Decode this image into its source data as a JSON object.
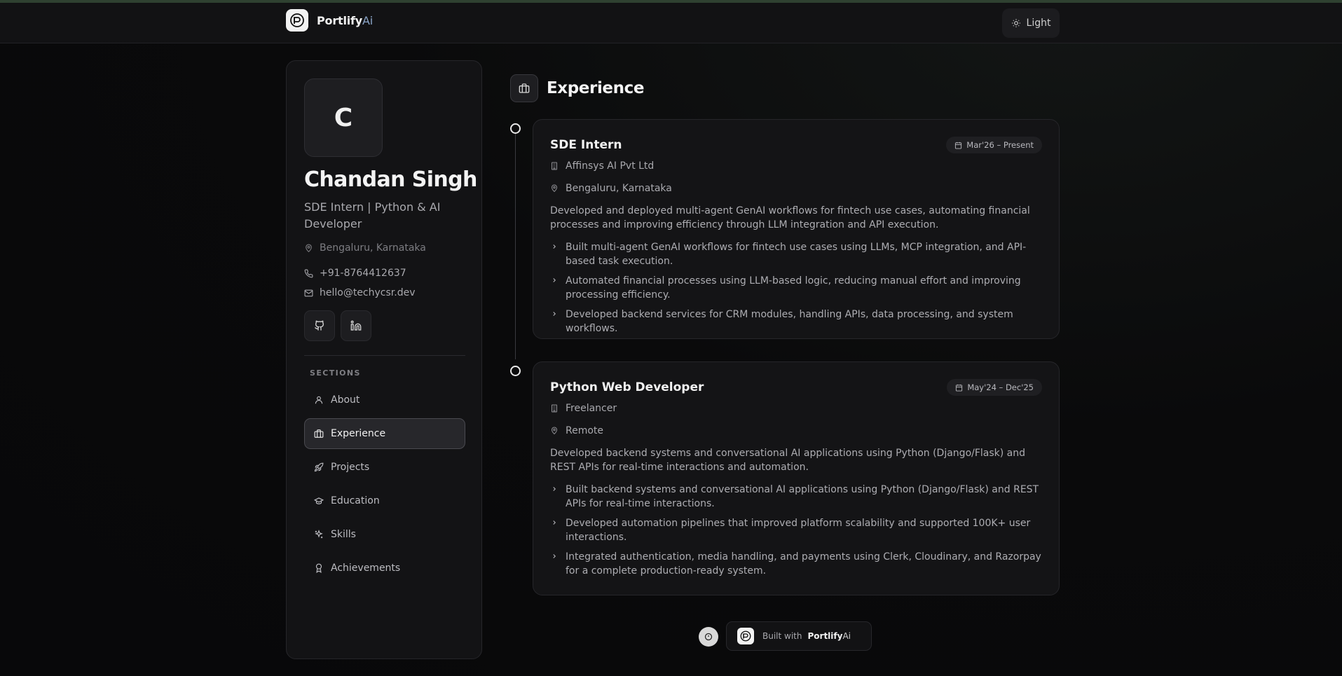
{
  "header": {
    "brand_name": "Portlify",
    "brand_suffix": "Ai",
    "theme_toggle_label": "Light"
  },
  "profile": {
    "avatar_initial": "C",
    "name": "Chandan Singh",
    "tagline": "SDE Intern | Python & AI Developer",
    "location": "Bengaluru, Karnataka",
    "phone": "+91-8764412637",
    "email": "hello@techycsr.dev",
    "socials": [
      "github-icon",
      "linkedin-icon"
    ]
  },
  "sidebar": {
    "sections_label": "SECTIONS",
    "items": [
      {
        "label": "About",
        "icon": "user-icon",
        "active": false
      },
      {
        "label": "Experience",
        "icon": "briefcase-icon",
        "active": true
      },
      {
        "label": "Projects",
        "icon": "rocket-icon",
        "active": false
      },
      {
        "label": "Education",
        "icon": "graduation-cap-icon",
        "active": false
      },
      {
        "label": "Skills",
        "icon": "sparkles-icon",
        "active": false
      },
      {
        "label": "Achievements",
        "icon": "award-icon",
        "active": false
      }
    ]
  },
  "main": {
    "section_title": "Experience",
    "experiences": [
      {
        "role": "SDE Intern",
        "dates": "Mar'26 – Present",
        "company": "Affinsys AI Pvt Ltd",
        "location": "Bengaluru, Karnataka",
        "summary": "Developed and deployed multi-agent GenAI workflows for fintech use cases, automating financial processes and improving efficiency through LLM integration and API execution.",
        "bullets": [
          "Built multi-agent GenAI workflows for fintech use cases using LLMs, MCP integration, and API-based task execution.",
          "Automated financial processes using LLM-based logic, reducing manual effort and improving processing efficiency.",
          "Developed backend services for CRM modules, handling APIs, data processing, and system workflows."
        ]
      },
      {
        "role": "Python Web Developer",
        "dates": "May'24 – Dec'25",
        "company": "Freelancer",
        "location": "Remote",
        "summary": "Developed backend systems and conversational AI applications using Python (Django/Flask) and REST APIs for real-time interactions and automation.",
        "bullets": [
          "Built backend systems and conversational AI applications using Python (Django/Flask) and REST APIs for real-time interactions.",
          "Developed automation pipelines that improved platform scalability and supported 100K+ user interactions.",
          "Integrated authentication, media handling, and payments using Clerk, Cloudinary, and Razorpay for a complete production-ready system."
        ]
      }
    ]
  },
  "footer": {
    "built_with_label": "Built with",
    "brand_name": "Portlify",
    "brand_suffix": "Ai"
  }
}
